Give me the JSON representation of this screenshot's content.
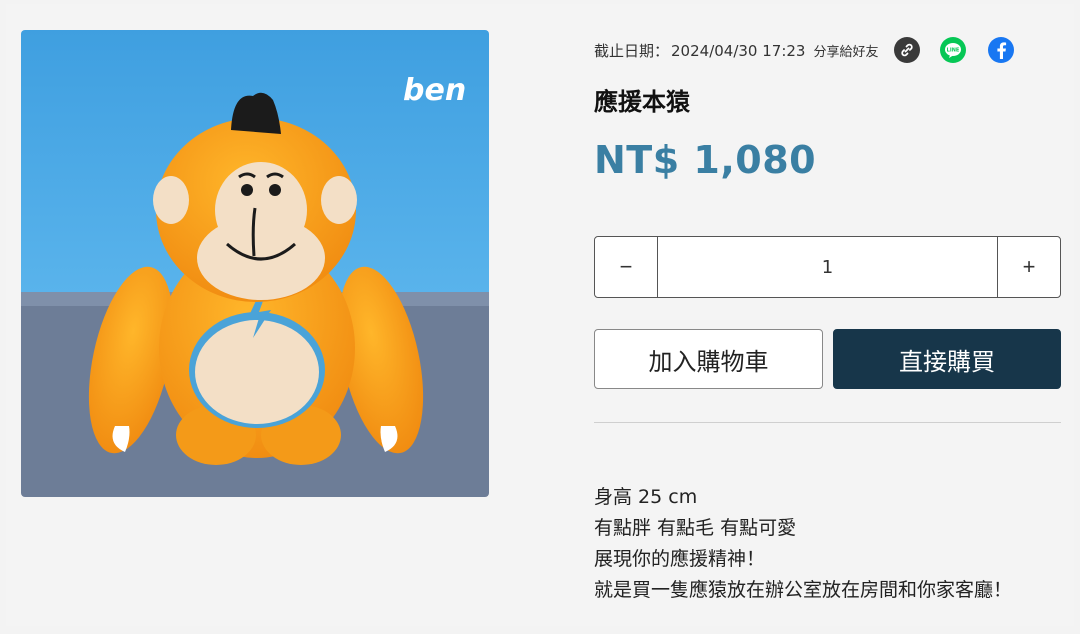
{
  "product": {
    "title": "應援本猿",
    "price": "NT$ 1,080",
    "image_alt": "orange plush toy",
    "image_logo": "ben"
  },
  "meta": {
    "deadline_label": "截止日期：",
    "deadline_value": "2024/04/30 17:23",
    "share_label": "分享給好友",
    "share_icons": [
      "link-icon",
      "line-icon",
      "facebook-icon"
    ],
    "line_text": "LINE"
  },
  "quantity": {
    "minus": "−",
    "plus": "+",
    "value": "1"
  },
  "actions": {
    "add_to_cart": "加入購物車",
    "buy_now": "直接購買"
  },
  "description": [
    "身高 25 cm",
    "有點胖 有點毛 有點可愛",
    "展現你的應援精神！",
    "就是買一隻應猿放在辦公室放在房間和你家客廳！"
  ],
  "colors": {
    "price": "#3a7fa3",
    "buy_button": "#17364a",
    "line": "#06c755",
    "facebook": "#1877f2"
  }
}
